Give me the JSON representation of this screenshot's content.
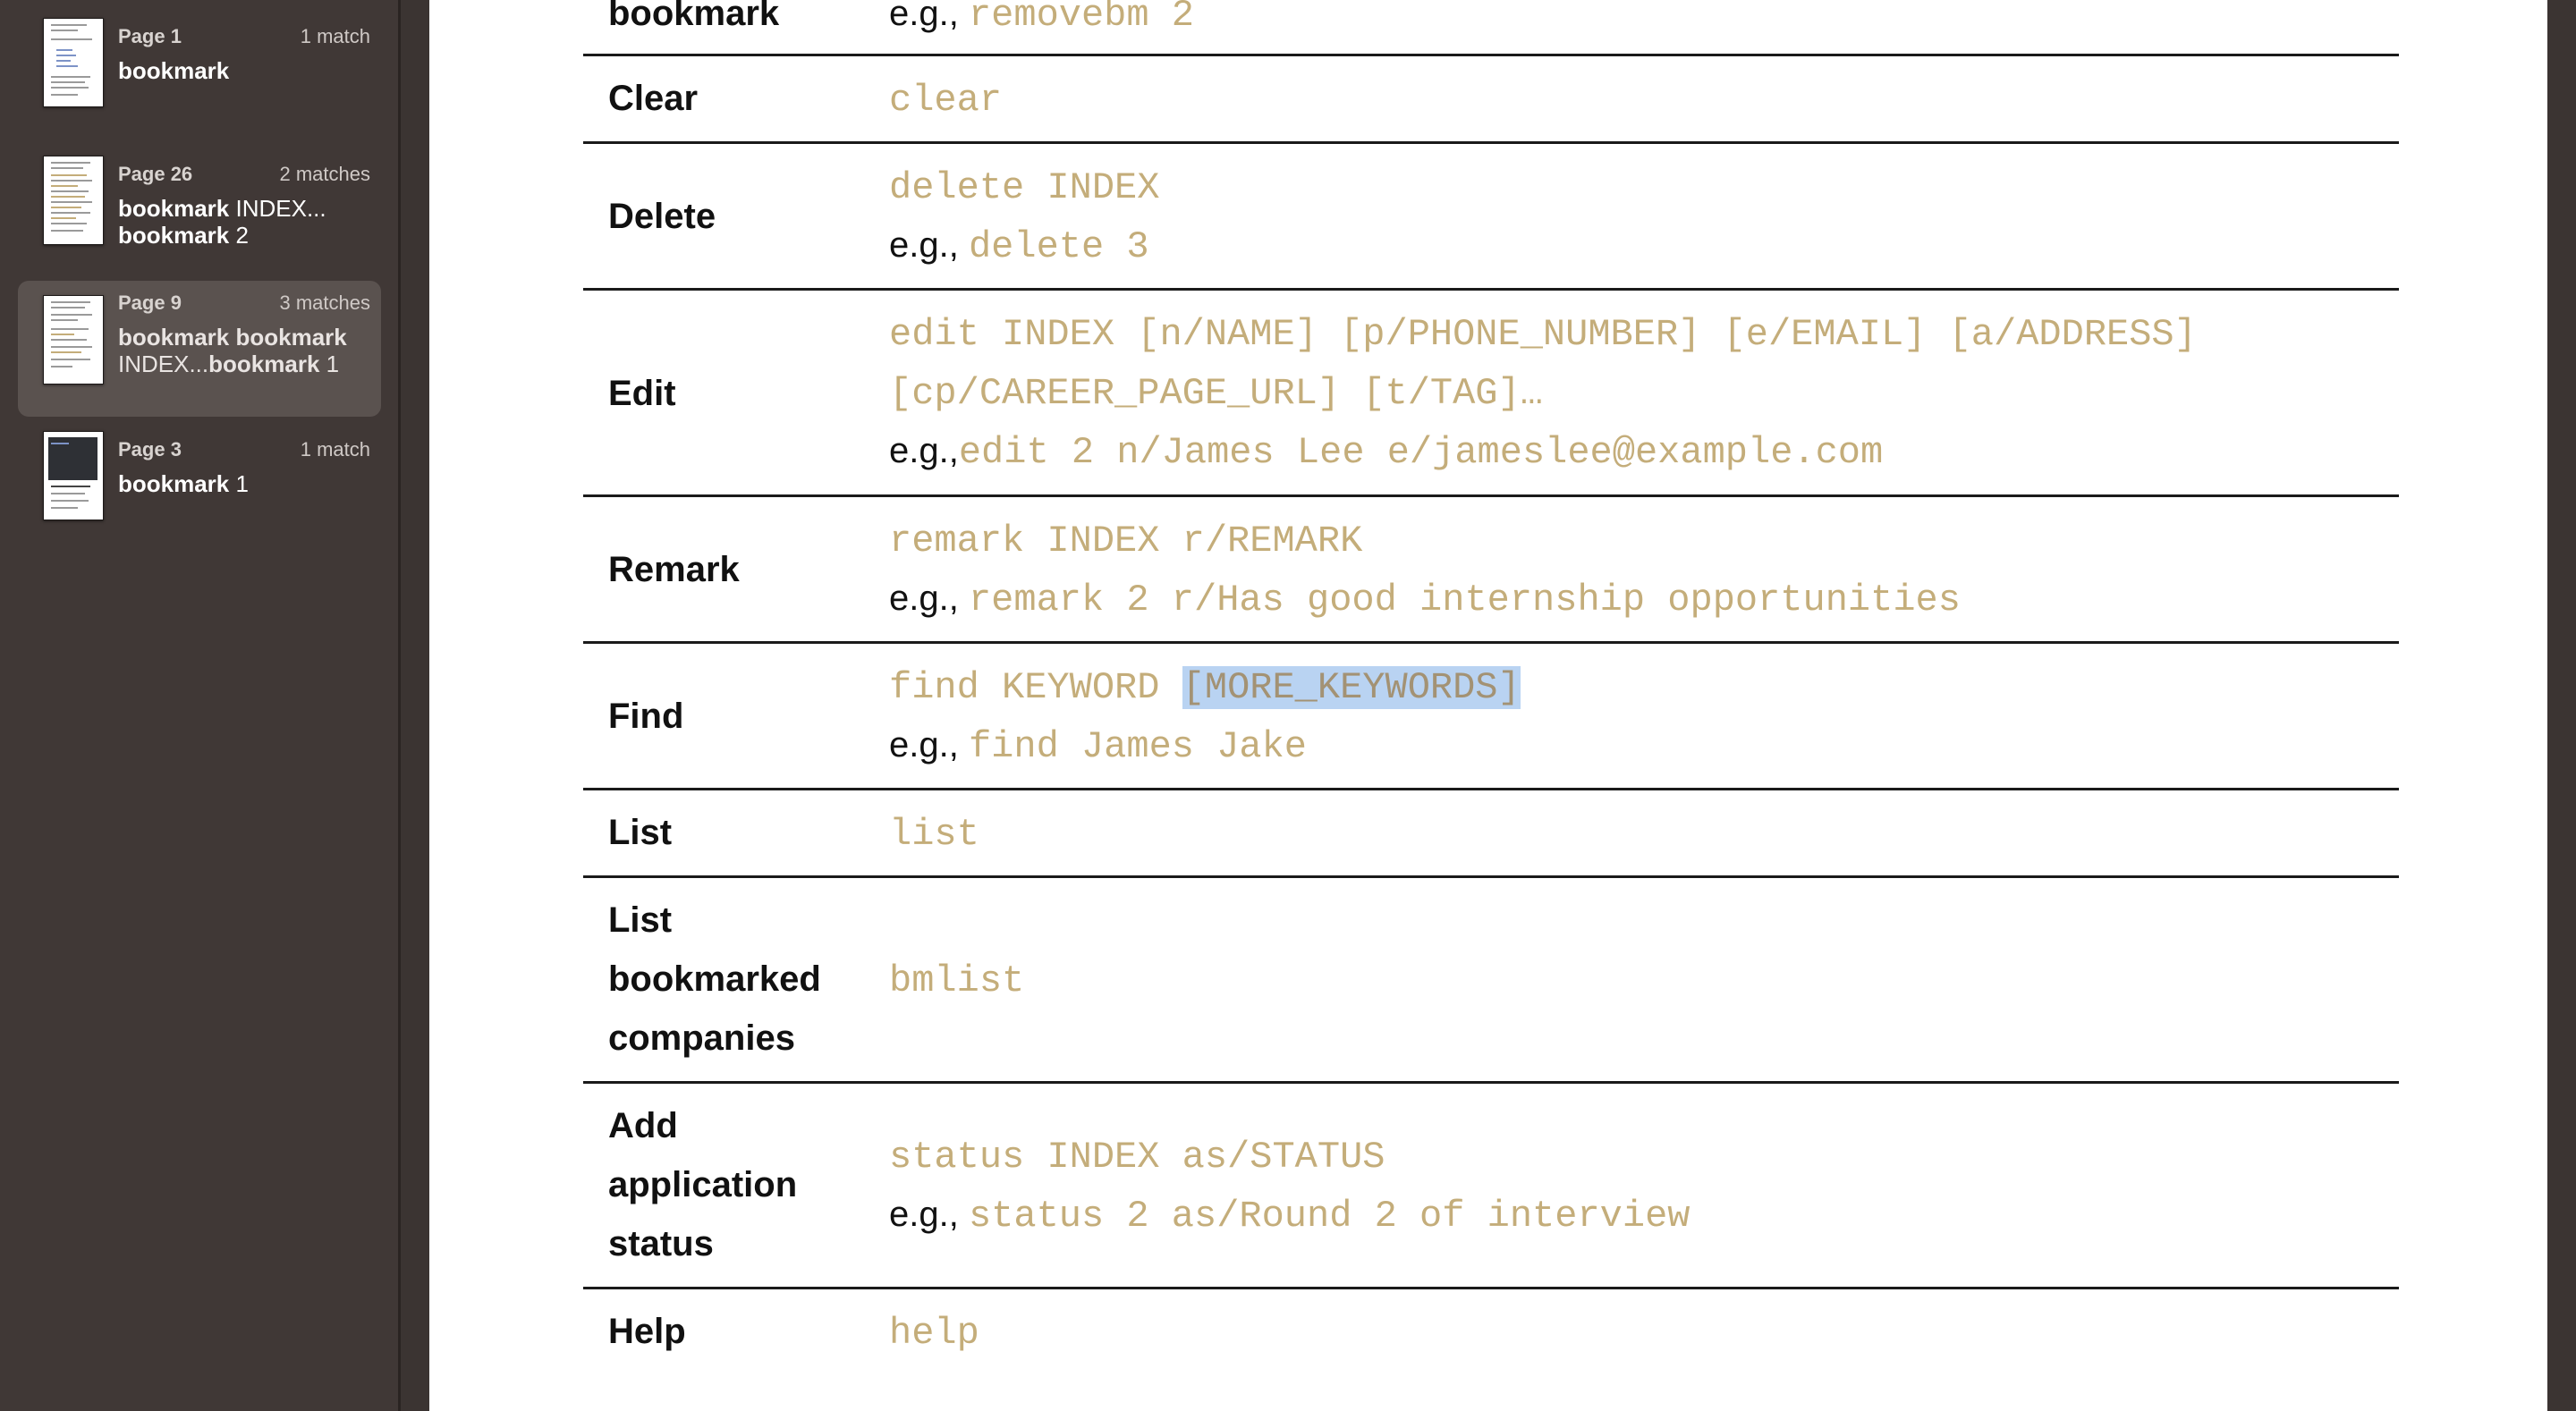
{
  "sidebar": {
    "results": [
      {
        "page": "Page 1",
        "count": "1 match",
        "snippet": [
          {
            "t": "bookmark",
            "b": true
          }
        ]
      },
      {
        "page": "Page 26",
        "count": "2 matches",
        "snippet": [
          {
            "t": "bookmark",
            "b": true
          },
          {
            "t": " INDEX...",
            "b": false
          },
          {
            "t": "bookmark",
            "b": true
          },
          {
            "t": " 2",
            "b": false
          }
        ]
      },
      {
        "page": "Page 9",
        "count": "3 matches",
        "snippet": [
          {
            "t": "bookmark bookmark",
            "b": true
          },
          {
            "t": "INDEX...",
            "b": false
          },
          {
            "t": "bookmark",
            "b": true
          },
          {
            "t": " 1",
            "b": false
          }
        ]
      },
      {
        "page": "Page 3",
        "count": "1 match",
        "snippet": [
          {
            "t": "bookmark",
            "b": true
          },
          {
            "t": " 1",
            "b": false
          }
        ]
      }
    ]
  },
  "table": {
    "rows": [
      {
        "label": "bookmark",
        "lines": [
          {
            "eg": "e.g., ",
            "code": "removebm 2"
          }
        ]
      },
      {
        "label": "Clear",
        "lines": [
          {
            "code": "clear"
          }
        ]
      },
      {
        "label": "Delete",
        "lines": [
          {
            "code": "delete INDEX"
          },
          {
            "eg": "e.g., ",
            "code": "delete 3"
          }
        ]
      },
      {
        "label": "Edit",
        "lines": [
          {
            "code": "edit INDEX [n/NAME] [p/PHONE_NUMBER] [e/EMAIL] [a/ADDRESS]"
          },
          {
            "code": "[cp/CAREER_PAGE_URL] [t/TAG]…"
          },
          {
            "eg": "e.g.,",
            "code": "edit 2 n/James Lee e/jameslee@example.com"
          }
        ]
      },
      {
        "label": "Remark",
        "lines": [
          {
            "code": "remark INDEX r/REMARK"
          },
          {
            "eg": "e.g., ",
            "code": "remark 2 r/Has good internship opportunities"
          }
        ]
      },
      {
        "label": "Find",
        "lines": [
          {
            "code": "find KEYWORD ",
            "highlight": "[MORE_KEYWORDS]"
          },
          {
            "eg": "e.g., ",
            "code": "find James Jake"
          }
        ]
      },
      {
        "label": "List",
        "lines": [
          {
            "code": "list"
          }
        ]
      },
      {
        "label": "List bookmarked companies",
        "lines": [
          {
            "code": "bmlist"
          }
        ]
      },
      {
        "label": "Add application status",
        "lines": [
          {
            "code": "status INDEX as/STATUS"
          },
          {
            "eg": "e.g., ",
            "code": "status 2 as/Round 2 of interview"
          }
        ]
      },
      {
        "label": "Help",
        "lines": [
          {
            "code": "help"
          }
        ]
      }
    ]
  }
}
